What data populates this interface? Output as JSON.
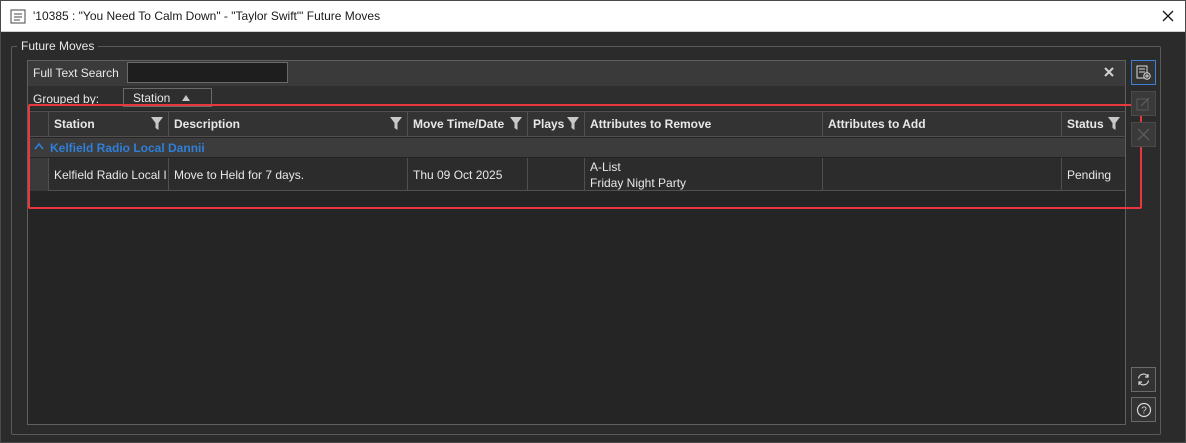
{
  "window": {
    "title": "'10385 : \"You Need To Calm Down\" - \"Taylor Swift\"' Future Moves"
  },
  "groupbox": {
    "label": "Future Moves"
  },
  "search": {
    "label": "Full Text Search",
    "value": "",
    "placeholder": ""
  },
  "grouping": {
    "label": "Grouped by:",
    "field": "Station",
    "sort": "ascending"
  },
  "columns": [
    {
      "label": "Station",
      "filterable": true
    },
    {
      "label": "Description",
      "filterable": true
    },
    {
      "label": "Move Time/Date",
      "filterable": true
    },
    {
      "label": "Plays",
      "filterable": true
    },
    {
      "label": "Attributes to Remove",
      "filterable": false
    },
    {
      "label": "Attributes to Add",
      "filterable": false
    },
    {
      "label": "Status",
      "filterable": true
    }
  ],
  "groups": [
    {
      "title": "Kelfield Radio Local Dannii",
      "expanded": true,
      "rows": [
        {
          "station": "Kelfield Radio Local I",
          "description": "Move to Held for 7 days.",
          "move_time": "Thu 09 Oct 2025",
          "plays": "",
          "attributes_remove": [
            "A-List",
            "Friday Night Party"
          ],
          "attributes_add": "",
          "status": "Pending"
        }
      ]
    }
  ],
  "side_buttons": [
    {
      "icon": "add-record-icon",
      "state": "active"
    },
    {
      "icon": "edit-icon",
      "state": "disabled"
    },
    {
      "icon": "delete-icon",
      "state": "disabled"
    },
    {
      "icon": "refresh-icon",
      "state": "enabled"
    },
    {
      "icon": "help-icon",
      "state": "enabled"
    }
  ],
  "colors": {
    "background": "#2b2b2b",
    "group_title": "#2f7fd9",
    "highlight_box": "#e8383d",
    "active_button_border": "#3b82d6"
  }
}
